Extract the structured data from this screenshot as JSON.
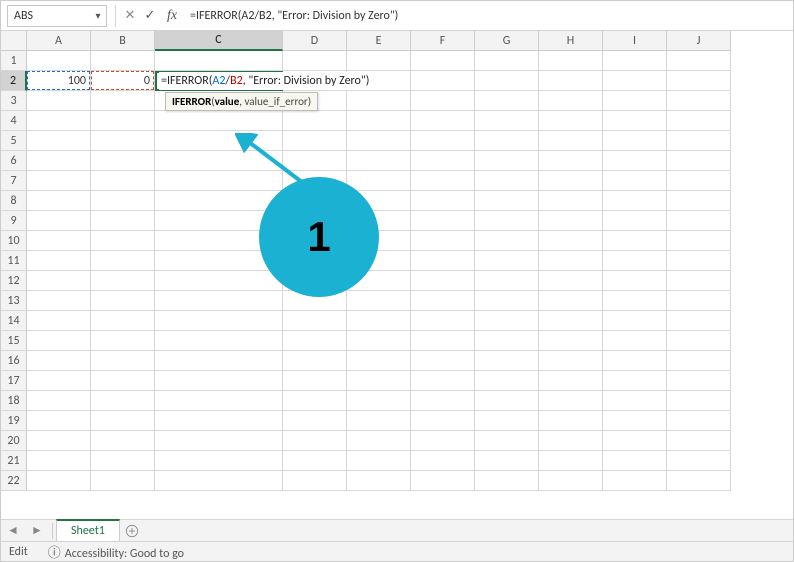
{
  "namebox": {
    "value": "ABS",
    "caret": "▾"
  },
  "formula_bar": {
    "cancel_glyph": "✕",
    "confirm_glyph": "✓",
    "fx_label": "fx",
    "formula_text": "=IFERROR(A2/B2, \"Error: Division by Zero\")"
  },
  "columns": [
    "A",
    "B",
    "C",
    "D",
    "E",
    "F",
    "G",
    "H",
    "I",
    "J"
  ],
  "active_col_index": 2,
  "wide_col_index": 2,
  "row_count": 22,
  "active_row": 2,
  "cell_values": {
    "A2": "100",
    "B2": "0"
  },
  "edit_formula": {
    "prefix": "=IFERROR(",
    "ref1": "A2",
    "slash": "/",
    "ref2": "B2",
    "suffix": ", \"Error: Division by Zero\")"
  },
  "tooltip": {
    "fn": "IFERROR",
    "sig_open": "(",
    "arg1": "value",
    "sep": ", ",
    "arg2": "value_if_error",
    "sig_close": ")"
  },
  "annotation": {
    "label": "1"
  },
  "sheet_tabs": {
    "active": "Sheet1"
  },
  "statusbar": {
    "mode": "Edit",
    "accessibility": "Accessibility: Good to go"
  }
}
